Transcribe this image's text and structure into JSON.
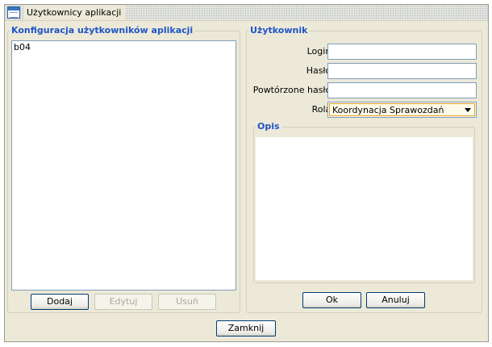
{
  "window": {
    "title": "Użytkownicy aplikacji",
    "icon": "window-icon"
  },
  "config_panel": {
    "legend": "Konfiguracja użytkowników aplikacji",
    "users": [
      "b04"
    ],
    "buttons": {
      "add": "Dodaj",
      "edit": "Edytuj",
      "delete": "Usuń"
    }
  },
  "user_panel": {
    "legend": "Użytkownik",
    "login_label": "Login:",
    "login_value": "",
    "password_label": "Hasło:",
    "password_value": "",
    "password_repeat_label": "Powtórzone hasło:",
    "password_repeat_value": "",
    "role_label": "Rola:",
    "role_value": "Koordynacja Sprawozdań",
    "description_legend": "Opis",
    "description_value": "",
    "buttons": {
      "ok": "Ok",
      "cancel": "Anuluj"
    }
  },
  "footer": {
    "close": "Zamknij"
  },
  "colors": {
    "legend": "#1f55c7",
    "window_bg": "#ece9d8",
    "field_border": "#7f9db9",
    "combo_focus": "#e3a21a"
  }
}
